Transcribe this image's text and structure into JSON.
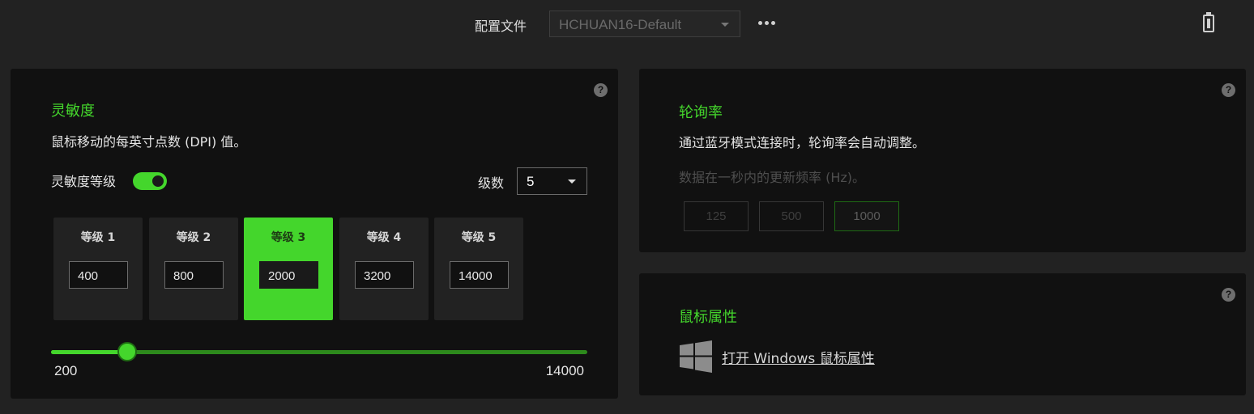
{
  "header": {
    "profile_label": "配置文件",
    "profile_value": "HCHUAN16-Default",
    "more_icon": "ellipsis-icon",
    "battery_icon": "battery-icon"
  },
  "sensitivity": {
    "title": "灵敏度",
    "description": "鼠标移动的每英寸点数 (DPI) 值。",
    "toggle_label": "灵敏度等级",
    "toggle_on": true,
    "levels_label": "级数",
    "levels_value": "5",
    "stages": [
      {
        "label": "等级 1",
        "value": "400"
      },
      {
        "label": "等级 2",
        "value": "800"
      },
      {
        "label": "等级 3",
        "value": "2000",
        "active": true
      },
      {
        "label": "等级 4",
        "value": "3200"
      },
      {
        "label": "等级 5",
        "value": "14000"
      }
    ],
    "slider": {
      "min": "200",
      "max": "14000",
      "current": 2000
    },
    "help": "?"
  },
  "polling": {
    "title": "轮询率",
    "description": "通过蓝牙模式连接时，轮询率会自动调整。",
    "hint": "数据在一秒内的更新频率 (Hz)。",
    "rates": [
      "125",
      "500",
      "1000"
    ],
    "selected": "1000",
    "help": "?"
  },
  "mouse_props": {
    "title": "鼠标属性",
    "link": "打开 Windows 鼠标属性",
    "icon": "windows-logo-icon",
    "help": "?"
  },
  "colors": {
    "accent": "#44d62c",
    "background": "#222222",
    "panel": "#111111"
  }
}
